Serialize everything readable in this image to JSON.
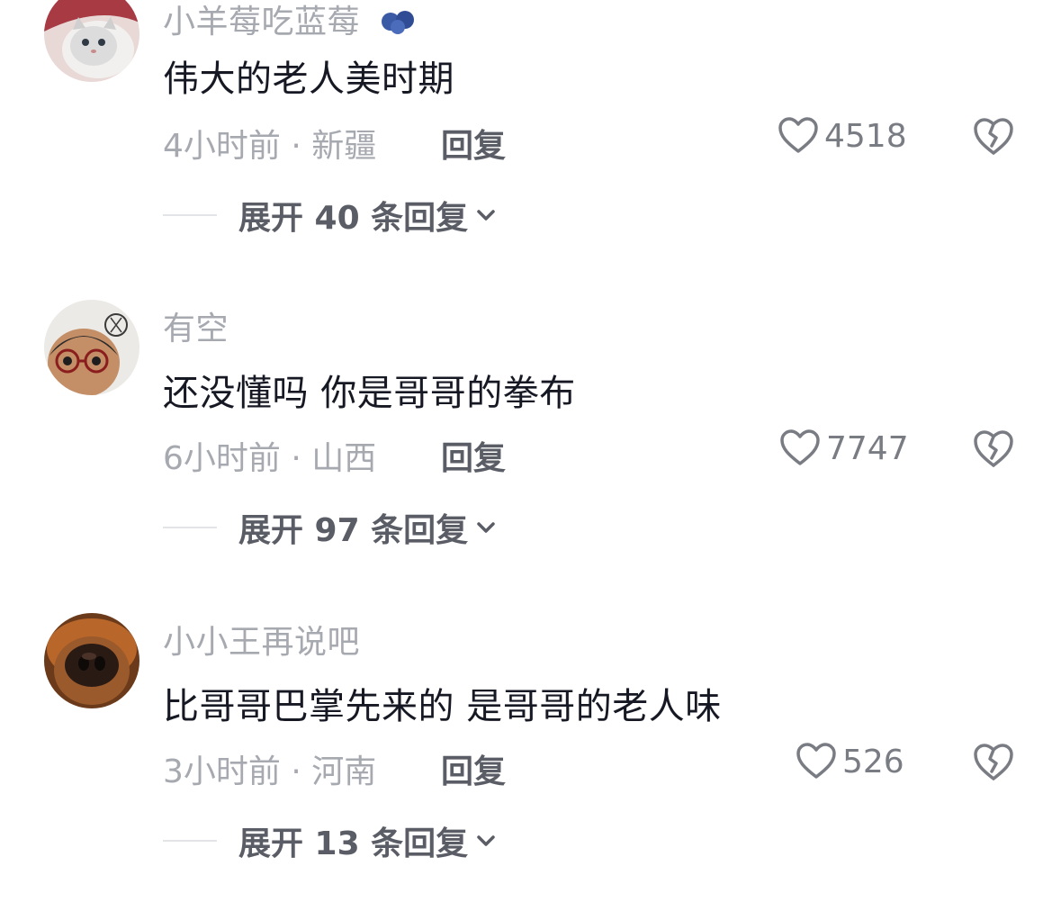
{
  "comments": [
    {
      "username": "小羊莓吃蓝莓",
      "text": "伟大的老人美时期",
      "meta": "4小时前 · 新疆",
      "reply_label": "回复",
      "likes": "4518",
      "expand_label": "展开 40 条回复",
      "avatar_icon": "cat-avatar"
    },
    {
      "username": "有空",
      "text": "还没懂吗 你是哥哥的拳布",
      "meta": "6小时前 · 山西",
      "reply_label": "回复",
      "likes": "7747",
      "expand_label": "展开 97 条回复",
      "avatar_icon": "glasses-avatar"
    },
    {
      "username": "小小王再说吧",
      "text": "比哥哥巴掌先来的 是哥哥的老人味",
      "meta": "3小时前 · 河南",
      "reply_label": "回复",
      "likes": "526",
      "expand_label": "展开 13 条回复",
      "avatar_icon": "dog-avatar"
    }
  ],
  "icons": {
    "like": "heart-outline-icon",
    "dislike": "broken-heart-icon",
    "expand": "chevron-down-icon"
  },
  "colors": {
    "text": "#161823",
    "secondary": "#a7a9b0",
    "reply": "#5b5d66"
  }
}
